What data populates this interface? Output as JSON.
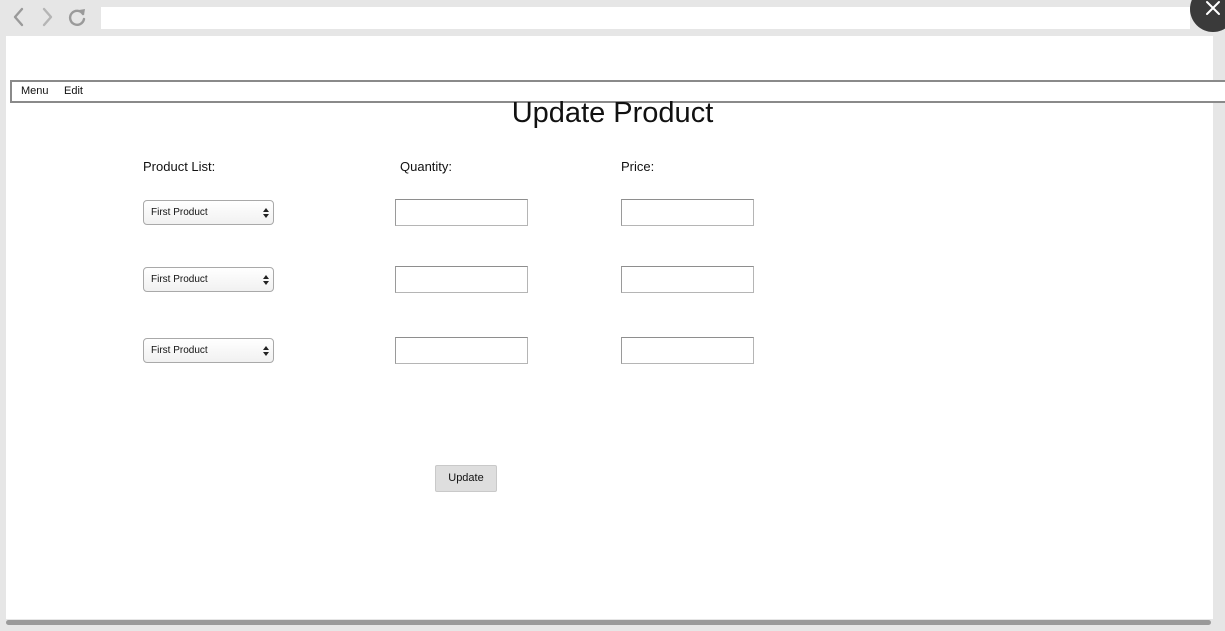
{
  "browser": {
    "address": "",
    "icons": [
      "back-icon",
      "forward-icon",
      "reload-icon",
      "close-icon",
      "menu-icon"
    ]
  },
  "menubar": {
    "items": [
      "Menu",
      "Edit"
    ]
  },
  "page": {
    "title": "Update Product",
    "columns": {
      "product": "Product List:",
      "quantity": "Quantity:",
      "price": "Price:"
    },
    "rows": [
      {
        "product": "First Product",
        "quantity": "",
        "price": ""
      },
      {
        "product": "First Product",
        "quantity": "",
        "price": ""
      },
      {
        "product": "First Product",
        "quantity": "",
        "price": ""
      }
    ],
    "submit_label": "Update"
  }
}
